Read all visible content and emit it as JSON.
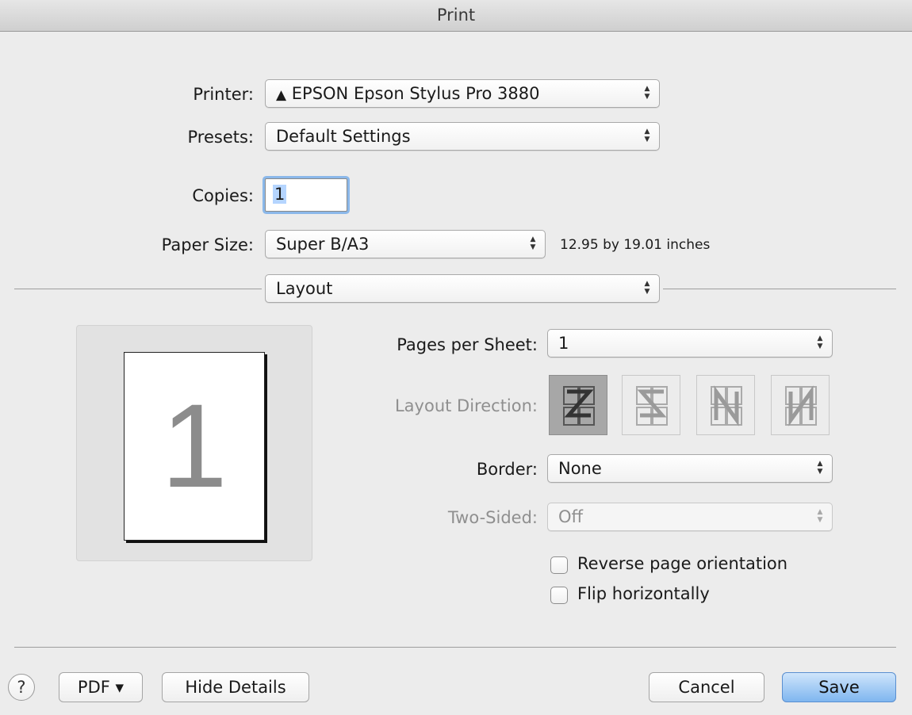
{
  "window": {
    "title": "Print"
  },
  "printer": {
    "label": "Printer:",
    "warning_icon": "▲",
    "value": "EPSON Epson Stylus Pro 3880"
  },
  "presets": {
    "label": "Presets:",
    "value": "Default Settings"
  },
  "copies": {
    "label": "Copies:",
    "value": "1"
  },
  "paper_size": {
    "label": "Paper Size:",
    "value": "Super B/A3",
    "dimensions": "12.95 by 19.01 inches"
  },
  "section": {
    "value": "Layout"
  },
  "preview": {
    "page_number": "1"
  },
  "layout": {
    "pages_per_sheet": {
      "label": "Pages per Sheet:",
      "value": "1"
    },
    "layout_direction": {
      "label": "Layout Direction:",
      "selected_index": 0
    },
    "border": {
      "label": "Border:",
      "value": "None"
    },
    "two_sided": {
      "label": "Two-Sided:",
      "value": "Off"
    },
    "reverse_orientation": {
      "label": "Reverse page orientation",
      "checked": false
    },
    "flip_horizontally": {
      "label": "Flip horizontally",
      "checked": false
    }
  },
  "footer": {
    "help": "?",
    "pdf": "PDF ▾",
    "hide_details": "Hide Details",
    "cancel": "Cancel",
    "save": "Save"
  },
  "colors": {
    "default_button": "#7fb6ef",
    "focus_ring": "#8bb8ea"
  }
}
